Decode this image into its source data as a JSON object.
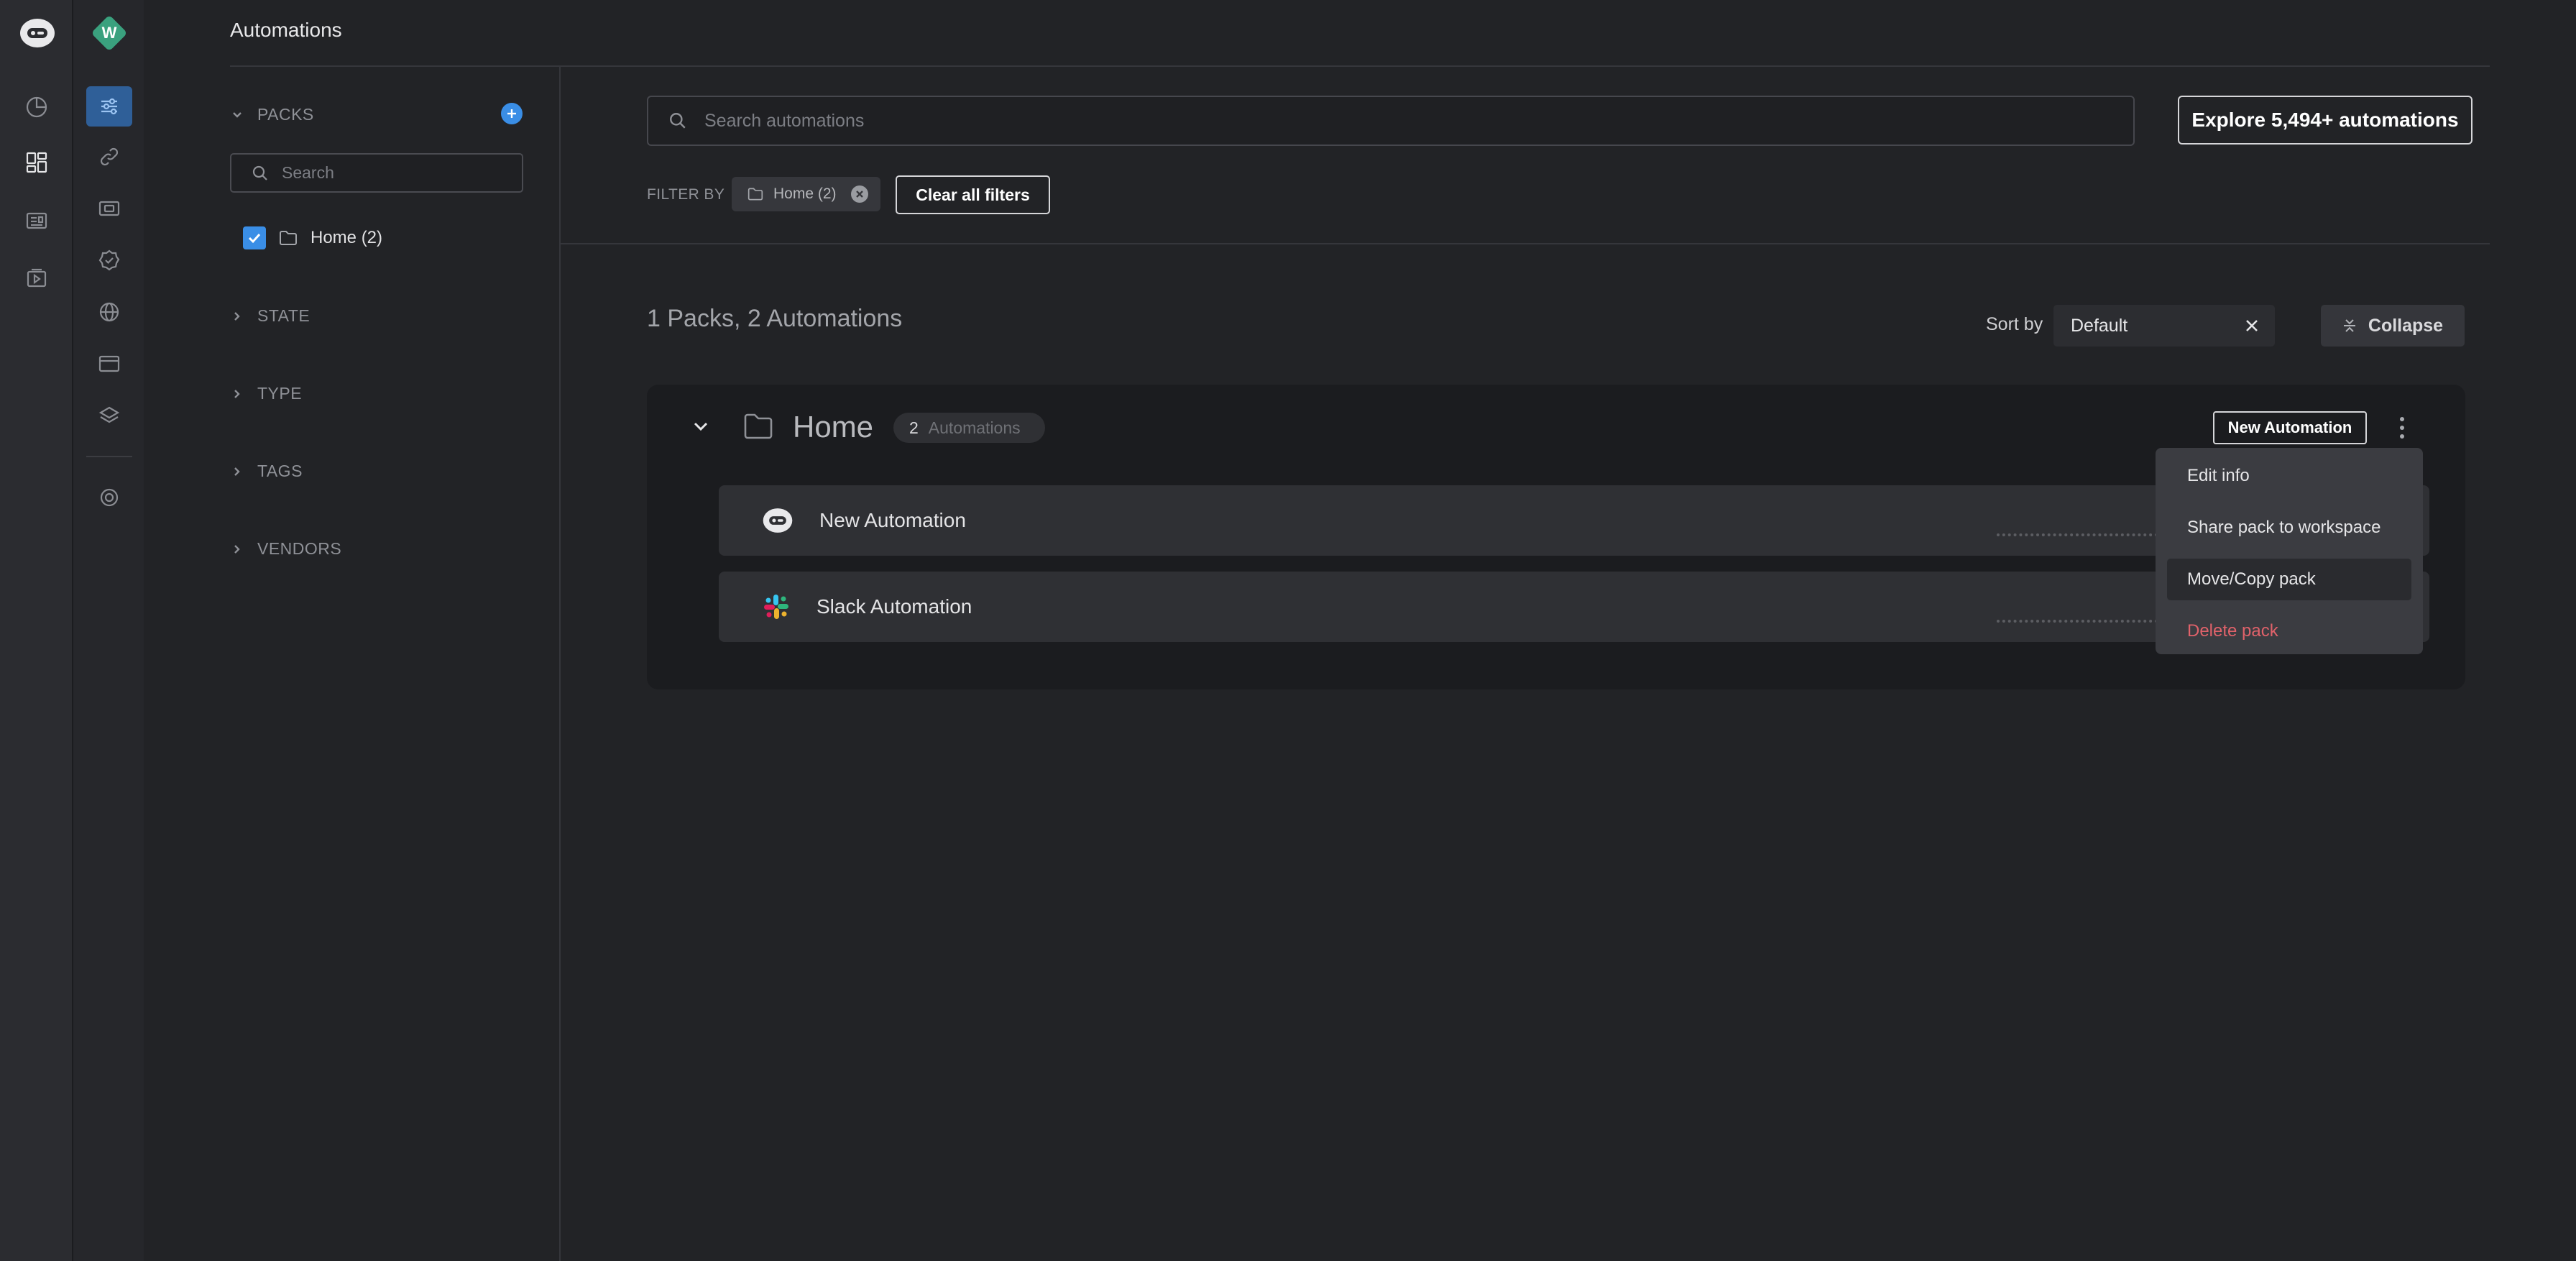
{
  "header": {
    "title": "Automations"
  },
  "rail": {
    "workspace_initial": "W",
    "icons": [
      "bot-logo-icon",
      "pie-chart-icon",
      "dashboard-grid-icon",
      "news-icon",
      "play-box-icon"
    ],
    "secondary_icons": [
      "automations-icon",
      "link-icon",
      "ticket-icon",
      "badge-check-icon",
      "globe-icon",
      "browser-window-icon",
      "layers-icon",
      "settings-icon"
    ]
  },
  "filters_panel": {
    "packs_label": "PACKS",
    "search_placeholder": "Search",
    "pack_items": [
      {
        "label": "Home (2)",
        "checked": true
      }
    ],
    "sections": [
      "STATE",
      "TYPE",
      "TAGS",
      "VENDORS"
    ]
  },
  "toolbar": {
    "search_placeholder": "Search automations",
    "explore_label": "Explore 5,494+ automations",
    "filter_by_label": "FILTER BY",
    "active_filter_chip": "Home (2)",
    "clear_filters_label": "Clear all filters"
  },
  "summary": {
    "count_text": "1 Packs, 2 Automations",
    "sort_by_label": "Sort by",
    "sort_value": "Default",
    "collapse_label": "Collapse"
  },
  "pack": {
    "title": "Home",
    "count": "2",
    "count_label": "Automations",
    "new_automation_label": "New Automation",
    "automations": [
      {
        "name": "New Automation",
        "icon": "bot-logo-icon"
      },
      {
        "name": "Slack Automation",
        "icon": "slack-icon"
      }
    ]
  },
  "context_menu": {
    "items": [
      {
        "label": "Edit info",
        "hovered": false,
        "danger": false
      },
      {
        "label": "Share pack to workspace",
        "hovered": false,
        "danger": false
      },
      {
        "label": "Move/Copy pack",
        "hovered": true,
        "danger": false
      },
      {
        "label": "Delete pack",
        "hovered": false,
        "danger": true
      }
    ]
  },
  "colors": {
    "accent_blue": "#3a8ee6",
    "active_rail_bg": "#2f5f98",
    "danger_red": "#e0626a",
    "workspace_badge": "#3aa17e"
  }
}
